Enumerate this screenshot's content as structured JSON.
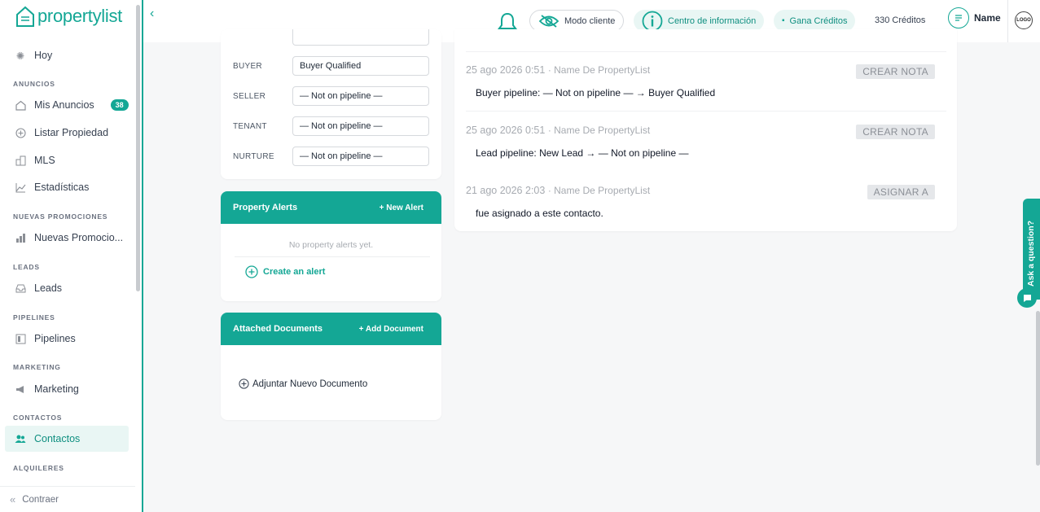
{
  "brand": {
    "logo_text": "propertylist"
  },
  "sidebar": {
    "items": [
      {
        "label": "Hoy",
        "icon": "sun-icon"
      },
      {
        "section": "ANUNCIOS"
      },
      {
        "label": "Mis Anuncios",
        "icon": "home-icon",
        "badge": "38"
      },
      {
        "label": "Listar Propiedad",
        "icon": "plus-circle-icon"
      },
      {
        "label": "MLS",
        "icon": "buildings-icon"
      },
      {
        "label": "Estadísticas",
        "icon": "trend-icon"
      },
      {
        "section": "NUEVAS PROMOCIONES"
      },
      {
        "label": "Nuevas Promocio...",
        "icon": "bar-chart-icon"
      },
      {
        "section": "LEADS"
      },
      {
        "label": "Leads",
        "icon": "inbox-icon"
      },
      {
        "section": "PIPELINES"
      },
      {
        "label": "Pipelines",
        "icon": "board-icon"
      },
      {
        "section": "MARKETING"
      },
      {
        "label": "Marketing",
        "icon": "megaphone-icon"
      },
      {
        "section": "CONTACTOS"
      },
      {
        "label": "Contactos",
        "icon": "users-icon",
        "active": true
      },
      {
        "section": "ALQUILERES"
      }
    ],
    "collapse_label": "Contraer"
  },
  "header": {
    "modo_cliente": "Modo cliente",
    "centro_info": "Centro de información",
    "gana_creditos": "Gana Créditos",
    "credits": "330 Créditos",
    "user_name": "Name",
    "badge_text": "LOGO"
  },
  "pipelines": {
    "rows": [
      {
        "label": "BUYER",
        "value": "Buyer Qualified"
      },
      {
        "label": "SELLER",
        "value": "— Not on pipeline —"
      },
      {
        "label": "TENANT",
        "value": "— Not on pipeline —"
      },
      {
        "label": "NURTURE",
        "value": "— Not on pipeline —"
      }
    ]
  },
  "property_alerts": {
    "title": "Property Alerts",
    "action": "+ New Alert",
    "empty": "No property alerts yet.",
    "create": "Create an alert"
  },
  "documents": {
    "title": "Attached Documents",
    "action": "+ Add Document",
    "attach": "Adjuntar Nuevo Documento"
  },
  "timeline": [
    {
      "date": "25 ago 2026 0:51",
      "author": "· Name De PropertyList",
      "tag": "CREAR NOTA",
      "body": "Buyer pipeline: — Not on pipeline — → Buyer Qualified"
    },
    {
      "date": "25 ago 2026 0:51",
      "author": "· Name De PropertyList",
      "tag": "CREAR NOTA",
      "body": "Lead pipeline: New Lead → — Not on pipeline —"
    },
    {
      "date": "21 ago 2026 2:03",
      "author": "· Name De PropertyList",
      "tag": "ASIGNAR A",
      "body": "fue asignado a este contacto."
    }
  ],
  "ask_question": "Ask a question?",
  "colors": {
    "accent": "#14a795",
    "accent_light": "#e9f6f4"
  }
}
